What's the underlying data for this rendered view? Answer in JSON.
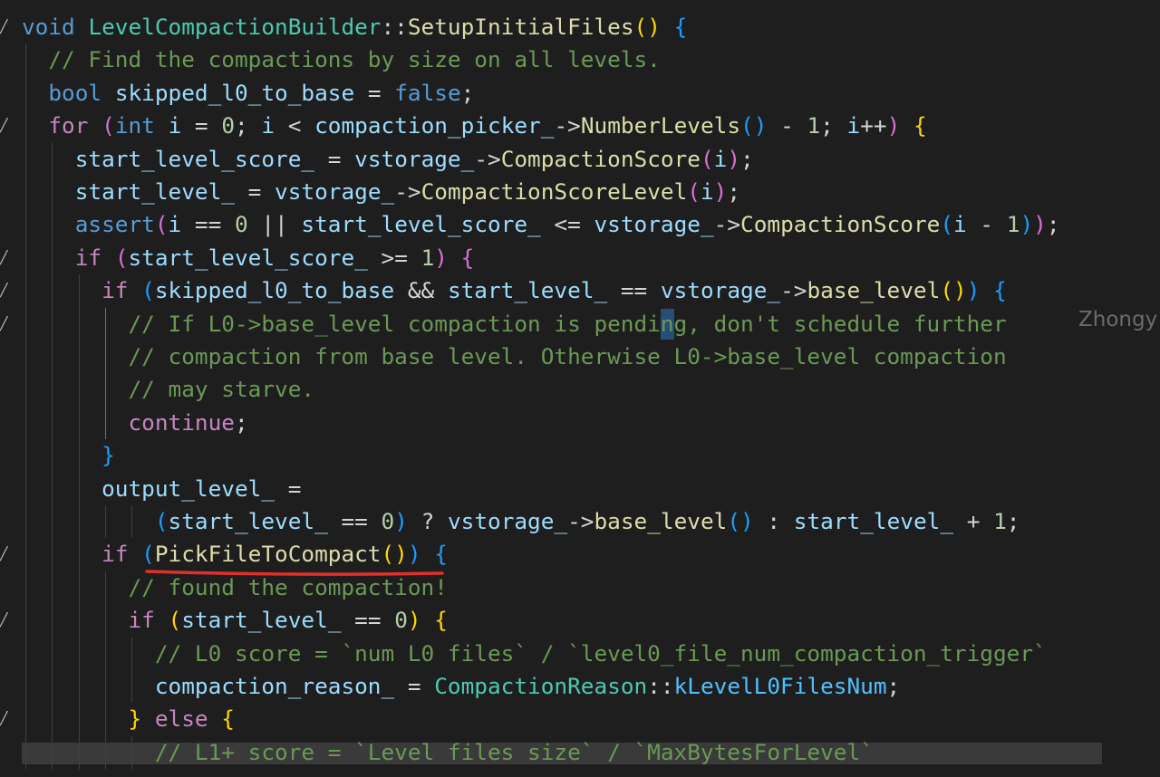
{
  "editor": {
    "blame_author": "Zhongy",
    "fold_icon": "chevron-fold-icon",
    "lines": [
      [
        "void LevelCompactionBuilder::SetupInitialFiles() {"
      ],
      [
        "  // Find the compactions by size on all levels."
      ],
      [
        "  bool skipped_l0_to_base = false;"
      ],
      [
        "  for (int i = 0; i < compaction_picker_->NumberLevels() - 1; i++) {"
      ],
      [
        "    start_level_score_ = vstorage_->CompactionScore(i);"
      ],
      [
        "    start_level_ = vstorage_->CompactionScoreLevel(i);"
      ],
      [
        "    assert(i == 0 || start_level_score_ <= vstorage_->CompactionScore(i - 1));"
      ],
      [
        "    if (start_level_score_ >= 1) {"
      ],
      [
        "      if (skipped_l0_to_base && start_level_ == vstorage_->base_level()) {"
      ],
      [
        "        // If L0->base_level compaction is pending, don't schedule further"
      ],
      [
        "        // compaction from base level. Otherwise L0->base_level compaction"
      ],
      [
        "        // may starve."
      ],
      [
        "        continue;"
      ],
      [
        "      }"
      ],
      [
        "      output_level_ ="
      ],
      [
        "          (start_level_ == 0) ? vstorage_->base_level() : start_level_ + 1;"
      ],
      [
        "      if (PickFileToCompact()) {"
      ],
      [
        "        // found the compaction!"
      ],
      [
        "        if (start_level_ == 0) {"
      ],
      [
        "          // L0 score = `num L0 files` / `level0_file_num_compaction_trigger`"
      ],
      [
        "          compaction_reason_ = CompactionReason::kLevelL0FilesNum;"
      ],
      [
        "        } else {"
      ],
      [
        "          // L1+ score = `Level files size` / `MaxBytesForLevel`"
      ]
    ]
  },
  "tokens": {
    "l0": [
      [
        "kw",
        "void"
      ],
      [
        "pun",
        " "
      ],
      [
        "typ",
        "LevelCompactionBuilder"
      ],
      [
        "pun",
        "::"
      ],
      [
        "fn",
        "SetupInitialFiles"
      ],
      [
        "b1",
        "()"
      ],
      [
        "pun",
        " "
      ],
      [
        "b3",
        "{"
      ]
    ],
    "l1": [
      [
        "pun",
        "  "
      ],
      [
        "cmt",
        "// Find the compactions by size on all levels."
      ]
    ],
    "l2": [
      [
        "pun",
        "  "
      ],
      [
        "kw",
        "bool"
      ],
      [
        "pun",
        " "
      ],
      [
        "var",
        "skipped_l0_to_base"
      ],
      [
        "pun",
        " = "
      ],
      [
        "kw",
        "false"
      ],
      [
        "pun",
        ";"
      ]
    ],
    "l3": [
      [
        "pun",
        "  "
      ],
      [
        "ctl",
        "for"
      ],
      [
        "pun",
        " "
      ],
      [
        "b2",
        "("
      ],
      [
        "kw",
        "int"
      ],
      [
        "pun",
        " "
      ],
      [
        "var",
        "i"
      ],
      [
        "pun",
        " = "
      ],
      [
        "num",
        "0"
      ],
      [
        "pun",
        "; "
      ],
      [
        "var",
        "i"
      ],
      [
        "pun",
        " < "
      ],
      [
        "var",
        "compaction_picker_"
      ],
      [
        "pun",
        "->"
      ],
      [
        "fn",
        "NumberLevels"
      ],
      [
        "b3",
        "()"
      ],
      [
        "pun",
        " - "
      ],
      [
        "num",
        "1"
      ],
      [
        "pun",
        "; "
      ],
      [
        "var",
        "i"
      ],
      [
        "pun",
        "++"
      ],
      [
        "b2",
        ")"
      ],
      [
        "pun",
        " "
      ],
      [
        "b1",
        "{"
      ]
    ],
    "l4": [
      [
        "pun",
        "    "
      ],
      [
        "var",
        "start_level_score_"
      ],
      [
        "pun",
        " = "
      ],
      [
        "var",
        "vstorage_"
      ],
      [
        "pun",
        "->"
      ],
      [
        "fn",
        "CompactionScore"
      ],
      [
        "b2",
        "("
      ],
      [
        "var",
        "i"
      ],
      [
        "b2",
        ")"
      ],
      [
        "pun",
        ";"
      ]
    ],
    "l5": [
      [
        "pun",
        "    "
      ],
      [
        "var",
        "start_level_"
      ],
      [
        "pun",
        " = "
      ],
      [
        "var",
        "vstorage_"
      ],
      [
        "pun",
        "->"
      ],
      [
        "fn",
        "CompactionScoreLevel"
      ],
      [
        "b2",
        "("
      ],
      [
        "var",
        "i"
      ],
      [
        "b2",
        ")"
      ],
      [
        "pun",
        ";"
      ]
    ],
    "l6": [
      [
        "pun",
        "    "
      ],
      [
        "kw",
        "assert"
      ],
      [
        "b2",
        "("
      ],
      [
        "var",
        "i"
      ],
      [
        "pun",
        " == "
      ],
      [
        "num",
        "0"
      ],
      [
        "pun",
        " || "
      ],
      [
        "var",
        "start_level_score_"
      ],
      [
        "pun",
        " <= "
      ],
      [
        "var",
        "vstorage_"
      ],
      [
        "pun",
        "->"
      ],
      [
        "fn",
        "CompactionScore"
      ],
      [
        "b3",
        "("
      ],
      [
        "var",
        "i"
      ],
      [
        "pun",
        " - "
      ],
      [
        "num",
        "1"
      ],
      [
        "b3",
        ")"
      ],
      [
        "b2",
        ")"
      ],
      [
        "pun",
        ";"
      ]
    ],
    "l7": [
      [
        "pun",
        "    "
      ],
      [
        "ctl",
        "if"
      ],
      [
        "pun",
        " "
      ],
      [
        "b2",
        "("
      ],
      [
        "var",
        "start_level_score_"
      ],
      [
        "pun",
        " >= "
      ],
      [
        "num",
        "1"
      ],
      [
        "b2",
        ")"
      ],
      [
        "pun",
        " "
      ],
      [
        "b2",
        "{"
      ]
    ],
    "l8": [
      [
        "pun",
        "      "
      ],
      [
        "ctl",
        "if"
      ],
      [
        "pun",
        " "
      ],
      [
        "b3",
        "("
      ],
      [
        "var",
        "skipped_l0_to_base"
      ],
      [
        "pun",
        " && "
      ],
      [
        "var",
        "start_level_"
      ],
      [
        "pun",
        " == "
      ],
      [
        "var",
        "vstorage_"
      ],
      [
        "pun",
        "->"
      ],
      [
        "fn",
        "base_level"
      ],
      [
        "b1",
        "()"
      ],
      [
        "b3",
        ")"
      ],
      [
        "pun",
        " "
      ],
      [
        "b3",
        "{"
      ]
    ],
    "l9": [
      [
        "pun",
        "        "
      ],
      [
        "cmt",
        "// If L0->base_level compaction is pending, don't schedule further"
      ]
    ],
    "l10": [
      [
        "pun",
        "        "
      ],
      [
        "cmt",
        "// compaction from base level. Otherwise L0->base_level compaction"
      ]
    ],
    "l11": [
      [
        "pun",
        "        "
      ],
      [
        "cmt",
        "// may starve."
      ]
    ],
    "l12": [
      [
        "pun",
        "        "
      ],
      [
        "ctl",
        "continue"
      ],
      [
        "pun",
        ";"
      ]
    ],
    "l13": [
      [
        "pun",
        "      "
      ],
      [
        "b3",
        "}"
      ]
    ],
    "l14": [
      [
        "pun",
        "      "
      ],
      [
        "var",
        "output_level_"
      ],
      [
        "pun",
        " ="
      ]
    ],
    "l15": [
      [
        "pun",
        "          "
      ],
      [
        "b3",
        "("
      ],
      [
        "var",
        "start_level_"
      ],
      [
        "pun",
        " == "
      ],
      [
        "num",
        "0"
      ],
      [
        "b3",
        ")"
      ],
      [
        "pun",
        " ? "
      ],
      [
        "var",
        "vstorage_"
      ],
      [
        "pun",
        "->"
      ],
      [
        "fn",
        "base_level"
      ],
      [
        "b3",
        "()"
      ],
      [
        "pun",
        " : "
      ],
      [
        "var",
        "start_level_"
      ],
      [
        "pun",
        " + "
      ],
      [
        "num",
        "1"
      ],
      [
        "pun",
        ";"
      ]
    ],
    "l16": [
      [
        "pun",
        "      "
      ],
      [
        "ctl",
        "if"
      ],
      [
        "pun",
        " "
      ],
      [
        "b3",
        "("
      ],
      [
        "fn",
        "PickFileToCompact"
      ],
      [
        "b1",
        "()"
      ],
      [
        "b3",
        ")"
      ],
      [
        "pun",
        " "
      ],
      [
        "b3",
        "{"
      ]
    ],
    "l17": [
      [
        "pun",
        "        "
      ],
      [
        "cmt",
        "// found the compaction!"
      ]
    ],
    "l18": [
      [
        "pun",
        "        "
      ],
      [
        "ctl",
        "if"
      ],
      [
        "pun",
        " "
      ],
      [
        "b1",
        "("
      ],
      [
        "var",
        "start_level_"
      ],
      [
        "pun",
        " == "
      ],
      [
        "num",
        "0"
      ],
      [
        "b1",
        ")"
      ],
      [
        "pun",
        " "
      ],
      [
        "b1",
        "{"
      ]
    ],
    "l19": [
      [
        "pun",
        "          "
      ],
      [
        "cmt",
        "// L0 score = `num L0 files` / `level0_file_num_compaction_trigger`"
      ]
    ],
    "l20": [
      [
        "pun",
        "          "
      ],
      [
        "var",
        "compaction_reason_"
      ],
      [
        "pun",
        " = "
      ],
      [
        "typ",
        "CompactionReason"
      ],
      [
        "pun",
        "::"
      ],
      [
        "enum",
        "kLevelL0FilesNum"
      ],
      [
        "pun",
        ";"
      ]
    ],
    "l21": [
      [
        "pun",
        "        "
      ],
      [
        "b1",
        "}"
      ],
      [
        "pun",
        " "
      ],
      [
        "ctl",
        "else"
      ],
      [
        "pun",
        " "
      ],
      [
        "b1",
        "{"
      ]
    ],
    "l22": [
      [
        "pun",
        "          "
      ],
      [
        "cmt",
        "// L1+ score = `Level files size` / `MaxBytesForLevel`"
      ]
    ]
  },
  "colors": {
    "background": "#1e1e1e",
    "comment": "#6a9955",
    "keyword": "#569cd6",
    "control": "#c586c0",
    "function": "#dcdcaa",
    "variable": "#9cdcfe",
    "type": "#4ec9b0",
    "number": "#b5cea8",
    "annotation_underline": "#e0312b"
  }
}
